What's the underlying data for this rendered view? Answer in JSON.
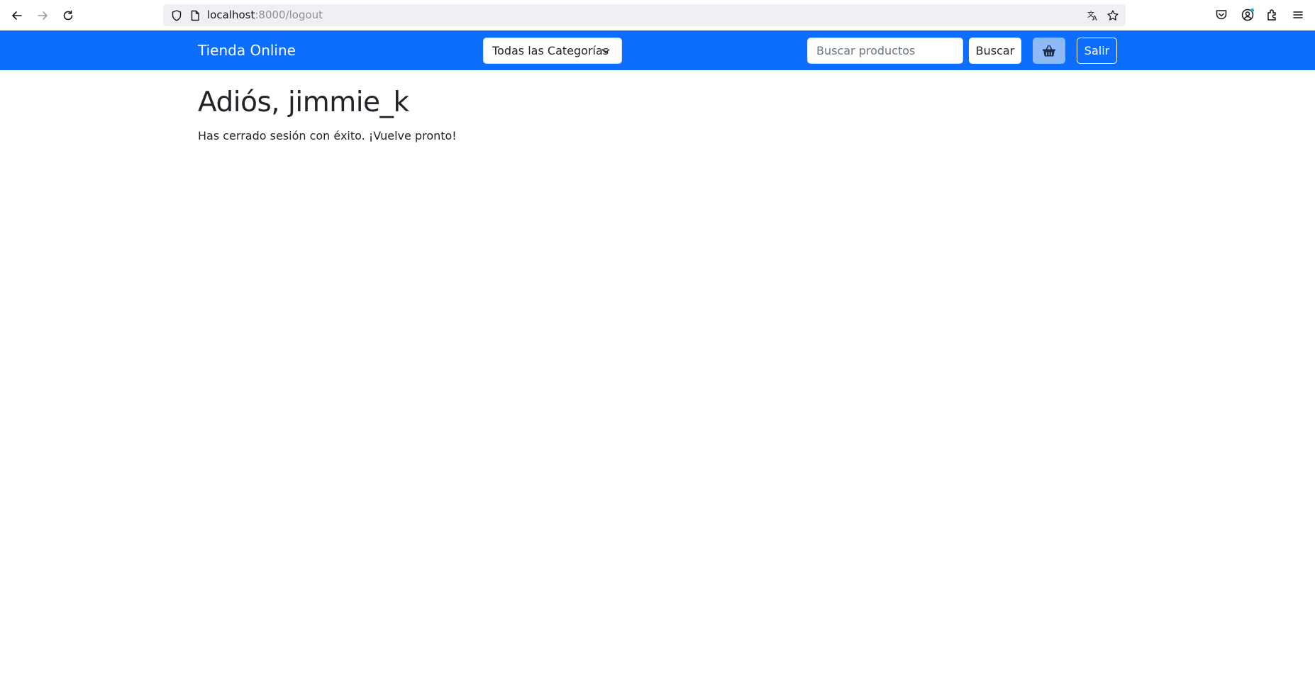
{
  "browser": {
    "url_host": "localhost",
    "url_path": ":8000/logout"
  },
  "navbar": {
    "brand": "Tienda Online",
    "category_select": "Todas las Categorías",
    "search_placeholder": "Buscar productos",
    "search_button": "Buscar",
    "cart_icon": "basket-icon",
    "logout_button": "Salir",
    "color": "#0d6efd"
  },
  "main": {
    "title": "Adiós, jimmie_k",
    "message": "Has cerrado sesión con éxito. ¡Vuelve pronto!"
  }
}
